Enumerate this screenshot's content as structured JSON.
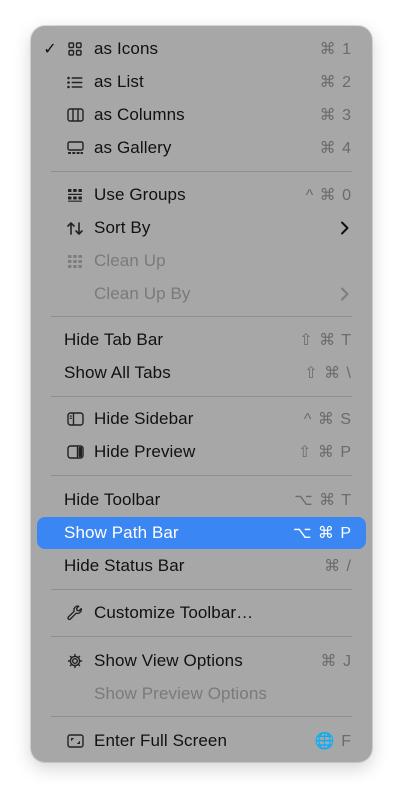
{
  "menu": {
    "items": [
      {
        "label": "as Icons",
        "shortcut": "⌘ 1",
        "checked": true,
        "check": "✓",
        "icon": "icon-grid-icon"
      },
      {
        "label": "as List",
        "shortcut": "⌘ 2",
        "icon": "list-icon"
      },
      {
        "label": "as Columns",
        "shortcut": "⌘ 3",
        "icon": "columns-icon"
      },
      {
        "label": "as Gallery",
        "shortcut": "⌘ 4",
        "icon": "gallery-icon"
      },
      {
        "label": "Use Groups",
        "shortcut": "^ ⌘ 0",
        "icon": "groups-icon"
      },
      {
        "label": "Sort By",
        "submenu": true,
        "icon": "sort-arrows-icon"
      },
      {
        "label": "Clean Up",
        "disabled": true,
        "icon": "cleanup-grid-icon"
      },
      {
        "label": "Clean Up By",
        "disabled": true,
        "submenu": true
      },
      {
        "label": "Hide Tab Bar",
        "shortcut": "⇧ ⌘ T"
      },
      {
        "label": "Show All Tabs",
        "shortcut": "⇧ ⌘ \\"
      },
      {
        "label": "Hide Sidebar",
        "shortcut": "^ ⌘ S",
        "icon": "sidebar-icon"
      },
      {
        "label": "Hide Preview",
        "shortcut": "⇧ ⌘ P",
        "icon": "preview-icon"
      },
      {
        "label": "Hide Toolbar",
        "shortcut": "⌥ ⌘ T"
      },
      {
        "label": "Show Path Bar",
        "shortcut": "⌥ ⌘ P",
        "highlighted": true
      },
      {
        "label": "Hide Status Bar",
        "shortcut": "⌘ /"
      },
      {
        "label": "Customize Toolbar…",
        "icon": "wrench-icon"
      },
      {
        "label": "Show View Options",
        "shortcut": "⌘ J",
        "icon": "gear-icon"
      },
      {
        "label": "Show Preview Options",
        "disabled": true
      },
      {
        "label": "Enter Full Screen",
        "shortcut": "🌐 F",
        "icon": "fullscreen-icon"
      }
    ]
  },
  "colors": {
    "menu_background": "#a7a7a7",
    "highlight": "#3a86f2",
    "text": "#111111",
    "disabled_text": "#7a7a7a",
    "shortcut_text": "#6b6b6b"
  }
}
